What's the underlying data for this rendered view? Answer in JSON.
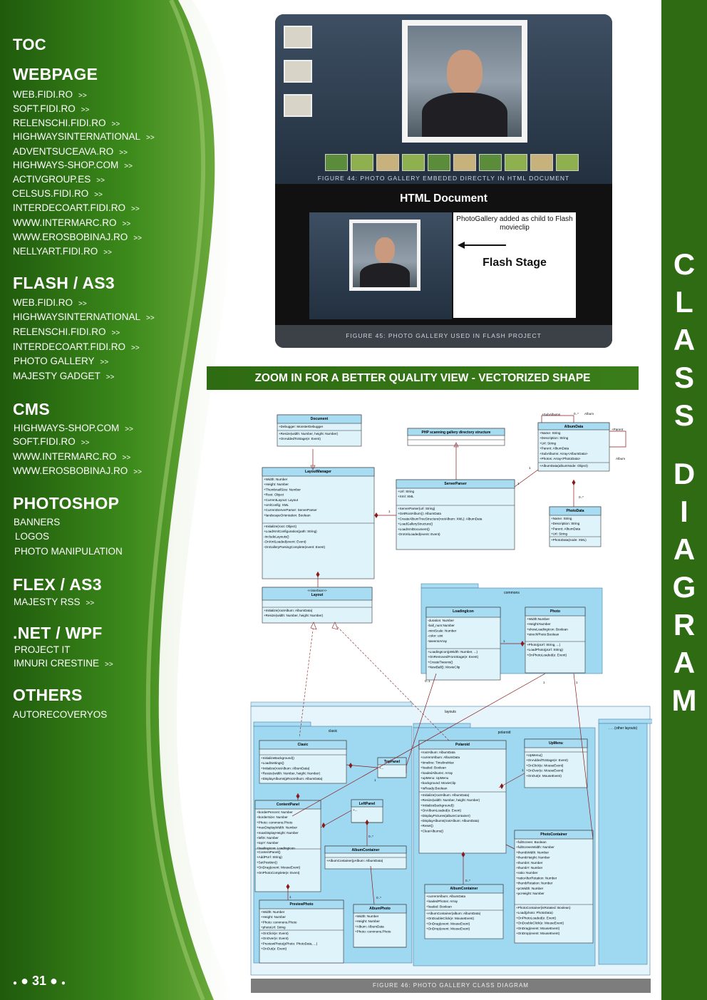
{
  "sidebar": {
    "toc_title": "TOC",
    "sections": [
      {
        "title": "WEBPAGE",
        "links": [
          "WEB.FIDI.RO",
          "SOFT.FIDI.RO",
          "RELENSCHI.FIDI.RO",
          "HIGHWAYSINTERNATIONAL",
          "ADVENTSUCEAVA.RO",
          "HIGHWAYS-SHOP.COM",
          "ACTIVGROUP.ES",
          "CELSUS.FIDI.RO",
          "INTERDECOART.FIDI.RO",
          "WWW.INTERMARC.RO",
          "WWW.EROSBOBINAJ.RO",
          "NELLYART.FIDI.RO"
        ]
      },
      {
        "title": "FLASH / AS3",
        "links": [
          "WEB.FIDI.RO",
          "HIGHWAYSINTERNATIONAL",
          "RELENSCHI.FIDI.RO",
          "INTERDECOART.FIDI.RO",
          "PHOTO GALLERY",
          "MAJESTY GADGET"
        ]
      },
      {
        "title": "CMS",
        "links": [
          "HIGHWAYS-SHOP.COM",
          "SOFT.FIDI.RO",
          "WWW.INTERMARC.RO",
          "WWW.EROSBOBINAJ.RO"
        ]
      },
      {
        "title": "PHOTOSHOP",
        "items": [
          "BANNERS",
          "LOGOS",
          "PHOTO MANIPULATION"
        ]
      },
      {
        "title": "FLEX / AS3",
        "links": [
          "MAJESTY RSS"
        ]
      },
      {
        "title": ".NET / WPF",
        "items": [
          "PROJECT IT"
        ],
        "links": [
          "IMNURI CRESTINE"
        ]
      },
      {
        "title": "OTHERS",
        "items": [
          "AUTORECOVERYOS"
        ]
      }
    ],
    "arrow": ">>",
    "page_number": "31"
  },
  "right_bar": {
    "vertical_title": [
      "C",
      "L",
      "A",
      "S",
      "S",
      "D",
      "I",
      "A",
      "G",
      "R",
      "A",
      "M"
    ]
  },
  "gallery": {
    "figure44_caption": "FIGURE 44: PHOTO GALLERY EMBEDED DIRECTLY IN HTML DOCUMENT",
    "html_document_label": "HTML Document",
    "flash_note": "PhotoGallery added as child to Flash movieclip",
    "flash_stage_label": "Flash Stage",
    "figure45_caption": "FIGURE 45: PHOTO GALLERY USED IN FLASH PROJECT"
  },
  "zoom_banner": "ZOOM IN  FOR A BETTER QUALITY VIEW - VECTORIZED SHAPE",
  "diagram": {
    "caption": "FIGURE 46: PHOTO GALLERY CLASS DIAGRAM",
    "packages": {
      "commons": "commons",
      "layouts": "layouts",
      "clasic": "clasic",
      "polaroid": "polaroid",
      "other": ". . . (other layouts)"
    },
    "classes": [
      {
        "id": "document",
        "name": "Document",
        "attrs": [
          "+Debugger: MonsterDebugger"
        ],
        "ops": [
          "+Resize(width: Number, height: Number)",
          "+OnAddedToStage(e: Event)"
        ]
      },
      {
        "id": "php",
        "name": "PHP scanning gallery directory structure",
        "attrs": [],
        "ops": []
      },
      {
        "id": "albumdata",
        "name": "AlbumData",
        "attrs": [
          "+Name: String",
          "+Description: String",
          "+Url: String",
          "+Parent: AlbumData",
          "+SubAlbums: Array<AlbumData>",
          "+Photos: Array<PhotoData>"
        ],
        "ops": [
          "+AlbumData(albumNode: Object)"
        ]
      },
      {
        "id": "layoutmanager",
        "name": "LayoutManager",
        "attrs": [
          "+Width: Number",
          "+Height: Number",
          "+ThumbnailSize: Number",
          "+Root: Object",
          "+CurrentLayout: Layout",
          "+xmlConfig: XML",
          "+CurrentServerParser: ServerParser",
          "+landscapeOrientation: Boolean"
        ],
        "ops": [
          "+Initialize(root: Object)",
          "+LoadXmlConfiguration(path: String)",
          "-IncludeLayouts()",
          "-OnXmlLoaded(event: Event)",
          "-OnGalleryParsingComplete(event: Event)"
        ]
      },
      {
        "id": "serverparser",
        "name": "ServerParser",
        "attrs": [
          "+Url: String",
          "+Xml: XML"
        ],
        "ops": [
          "+ServerParser(url: String)",
          "+GetRootAlbum(): AlbumData",
          "+CreateAlbumTreeStructure(rootAlbum: XML): AlbumData",
          "+LoadGalleryStructure()",
          "+LoadXmlDocument()",
          "-OnXmlLoaded(event: Event)"
        ]
      },
      {
        "id": "photodata",
        "name": "PhotoData",
        "attrs": [
          "+Name: String",
          "+Description: String",
          "+Parent: AlbumData",
          "+Url: String"
        ],
        "ops": [
          "+PhotoData(node: XML)"
        ]
      },
      {
        "id": "layout",
        "name": "Layout",
        "stereotype": "<<interface>>",
        "attrs": [],
        "ops": [
          "+Initialize(rootAlbum: AlbumData)",
          "+Resize(width: Number, height: Number)"
        ]
      },
      {
        "id": "loadingicon",
        "name": "LoadingIcon",
        "attrs": [
          "-duration: Number",
          "-ball_num:Number",
          "-miniScale: Number",
          "-color: uint",
          "-tweensArray"
        ],
        "ops": [
          "+LoadingIcon(pWidth: Number, ...)",
          "+OnRemovedFromStage(e: Event)",
          "+CreateTweens()",
          "+NewBall(): MovieClip"
        ]
      },
      {
        "id": "photo",
        "name": "Photo",
        "attrs": [
          "+Width:Number",
          "+Height:Number",
          "+showLoadingIcon: Boolean",
          "+strechPhoto:Boolean"
        ],
        "ops": [
          "+Photo(pUrl: String, ...)",
          "+LoadPhoto(pUrl: String)",
          "+OnPhotoLoaded(e: Event)"
        ]
      },
      {
        "id": "clasic",
        "name": "Clasic",
        "attrs": [],
        "ops": [
          "+InitializeBackground()",
          "+LoadSettings()",
          "+Initialize(rootAlbum: AlbumData)",
          "+Resize(width: Number, height: Number)",
          "+DisplayAlbums(pRootAlbum: AlbumData)"
        ]
      },
      {
        "id": "toppanel",
        "name": "TopPanel",
        "attrs": [
          "+..."
        ],
        "ops": []
      },
      {
        "id": "leftpanel",
        "name": "LeftPanel",
        "attrs": [
          "+..."
        ],
        "ops": []
      },
      {
        "id": "contentpanel",
        "name": "ContentPanel",
        "attrs": [
          "+borderPercent: Number",
          "+borderSize: Number",
          "+Photo: commons.Photo",
          "+maxDisplayWidth: Number",
          "+maxDisplayHeight: Number",
          "+leftX: Number",
          "+topY: Number",
          "+loadingIcon: LoadingIcon"
        ],
        "ops": [
          "+ContentPanel()",
          "+AddPUrl: String)",
          "+SetPosition()",
          "+OnDrag(event: MouseEvent)",
          "+OnPhotoComplete(e: Event)"
        ]
      },
      {
        "id": "albumcontainer1",
        "name": "AlbumContainer",
        "attrs": [],
        "ops": [
          "+AlbumContainer(pAlbum: AlbumData)"
        ]
      },
      {
        "id": "previewphoto",
        "name": "PreviewPhoto",
        "attrs": [
          "+Width: Number",
          "+Height: Number",
          "+Photo: commons.Photo",
          "+photoUrl: String"
        ],
        "ops": [
          "+OnClick(e: Event)",
          "+OnOver(e: Event)",
          "+PreviewPhoto(pPhoto: PhotoData, ...)",
          "+OnOut(e: Event)"
        ]
      },
      {
        "id": "albumphoto",
        "name": "AlbumPhoto",
        "attrs": [
          "+Width: Number",
          "+Height: Number",
          "+Album: AlbumData",
          "+Photo: commons.Photo"
        ],
        "ops": []
      },
      {
        "id": "polaroid",
        "name": "Polaroid",
        "attrs": [
          "+rootAlbum: AlbumData",
          "+currentAlbum: AlbumData",
          "+timeline: TimelineMax",
          "+loaded: Boolean",
          "+loadedAlbums: Array",
          "+upMenu: UpMenu",
          "+background: MovieClip",
          "+isReady:Boolean"
        ],
        "ops": [
          "+Initialize(rootAlbum: AlbumData)",
          "+Resize(width: Number, height: Number)",
          "+InitializeBackground()",
          "+OnAlbumLoaded(e: Event)",
          "+DisplayPictures(albumContainer)",
          "+DisplayAlbums(rootAlbum: AlbumData)",
          "+Reset()",
          "+ClearAlbums()"
        ]
      },
      {
        "id": "upmenu",
        "name": "UpMenu",
        "attrs": [],
        "ops": [
          "+UpMenu()",
          "+OnAddedToStage(e: Event)",
          "+OnClick(e: MouseEvent)",
          "+OnOver(e: MouseEvent)",
          "+OnOut(e: MouseEvent)"
        ]
      },
      {
        "id": "photocontainer",
        "name": "PhotoContainer",
        "attrs": [
          "+fullScreen: Boolean",
          "+fullScreenWidth: Number",
          "+thumbWidth: Number",
          "+thumbHeight: Number",
          "+thumbX: Number",
          "+thumbY: Number",
          "+ratio: Number",
          "+ratioAfterRotation: Number",
          "+thumbRotation: Number",
          "+pcWidth: Number",
          "+pcHeight: Number"
        ],
        "ops": [
          "+PhotoContainer(isRotated: Boolean)",
          "+Load(photo: PhotoData)",
          "+OnPhotoLoaded(e: Event)",
          "+OnDoubleClick(e: MouseEvent)",
          "+OnDrag(event: MouseEvent)",
          "+OnDrop(event: MouseEvent)"
        ]
      },
      {
        "id": "albumcontainer2",
        "name": "AlbumContainer",
        "attrs": [
          "+currentAlbum: AlbumData",
          "+loadedPhotos: Array",
          "+loaded: Boolean"
        ],
        "ops": [
          "+AlbumContainer(album: AlbumData)",
          "+OnDoubleClick(e: MouseEvent)",
          "+OnDrag(event: MouseEvent)",
          "+OnDrop(event: MouseEvent)"
        ]
      }
    ],
    "labels": [
      "+SubAlbums",
      "0..*",
      "Album",
      "+Parent",
      "Album",
      "0..*",
      "1",
      "1",
      "1",
      "1",
      "0..1",
      "1",
      "1",
      "1",
      "0..*",
      "0..*",
      "0..*",
      "1",
      "1"
    ]
  }
}
